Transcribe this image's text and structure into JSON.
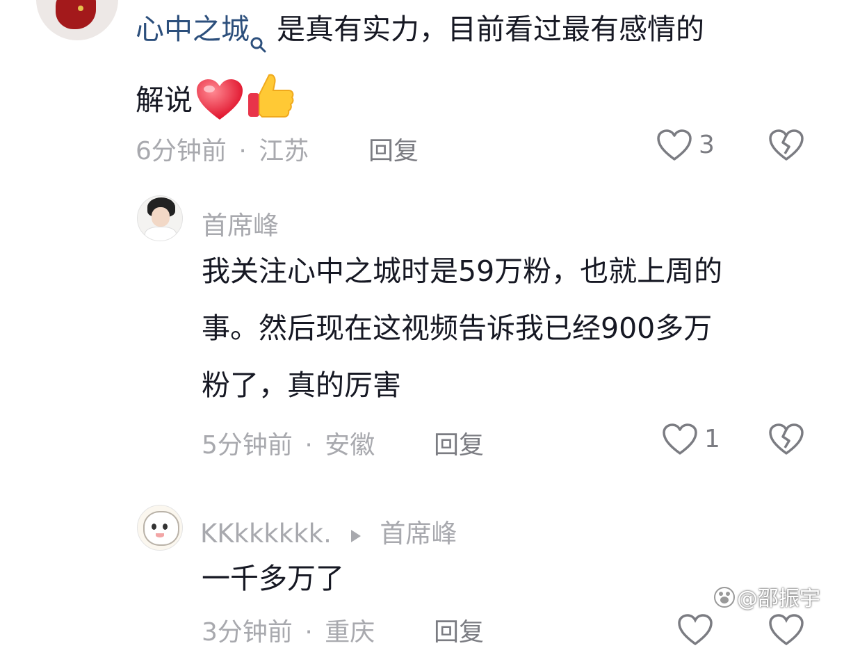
{
  "comments": [
    {
      "mention": "心中之城",
      "text": "是真有实力，目前看过最有感情的",
      "text_line2": "解说",
      "emojis": [
        "red-heart-icon",
        "thumbs-up-icon"
      ],
      "time": "6分钟前",
      "separator": "·",
      "location": "江苏",
      "reply_label": "回复",
      "like_count": "3"
    },
    {
      "author": "首席峰",
      "text_lines": [
        "我关注心中之城时是59万粉，也就上周的",
        "事。然后现在这视频告诉我已经900多万",
        "粉了，真的厉害"
      ],
      "time": "5分钟前",
      "separator": "·",
      "location": "安徽",
      "reply_label": "回复",
      "like_count": "1"
    },
    {
      "author": "KKkkkkkk.",
      "reply_to": "首席峰",
      "text": "一千多万了",
      "time": "3分钟前",
      "location": "重庆",
      "reply_label": "回复"
    }
  ],
  "watermark": "@邵振宇",
  "colors": {
    "mention": "#2c4f7c",
    "meta": "#a8a9ae",
    "text": "#161823"
  }
}
